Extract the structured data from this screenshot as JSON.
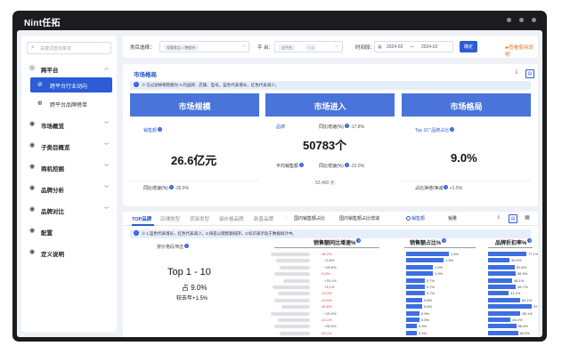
{
  "window": {
    "logo": "Nint任拓"
  },
  "sidebar": {
    "search_placeholder": "关键词查找菜单",
    "items": [
      {
        "label": "跨平台",
        "icon": "target-icon",
        "expanded": true
      },
      {
        "label": "跨平台行业动向",
        "sub": true,
        "active": true
      },
      {
        "label": "跨平台品牌榜单",
        "sub": true,
        "active": false
      },
      {
        "label": "市场概览",
        "icon": "grid-icon"
      },
      {
        "label": "子类目概览",
        "icon": "layers-icon"
      },
      {
        "label": "商机挖掘",
        "icon": "briefcase-icon"
      },
      {
        "label": "品牌分析",
        "icon": "chart-icon"
      },
      {
        "label": "品牌对比",
        "icon": "compare-icon"
      },
      {
        "label": "配置",
        "icon": "settings-icon"
      },
      {
        "label": "定义说明",
        "icon": "info-icon"
      }
    ]
  },
  "filters": {
    "category_label": "类目选择：",
    "category_tag": "保健食品 > 膳食补",
    "platform_label": "平 台：",
    "platform_tag": "全平台",
    "platform_more": "+ 4",
    "time_label": "时间段：",
    "date_start": "2024-02",
    "date_sep": "—",
    "date_end": "2024-02",
    "confirm_label": "确定",
    "help_label": "查看使用说明"
  },
  "market_panel": {
    "title": "市场格局",
    "notice": "① 已过滤掉销售额为 0 的品牌、店铺、型号。蓝色代表增长，红色代表减少。",
    "cards": [
      {
        "head": "市场规模",
        "metric_label": "销售额",
        "value": "26.6亿元",
        "yoy_label": "同比增速(%)",
        "yoy_value": "-35.9%"
      },
      {
        "head": "市场进入",
        "metric_label": "品牌",
        "yoy_label": "同比增速(%)",
        "yoy_value": "-17.8%",
        "value": "50783个",
        "avg_label": "平均销售额",
        "avg_yoy_label": "同比增速(%)",
        "avg_yoy_value": "-22.0%",
        "avg_value": "52,460 元"
      },
      {
        "head": "市场格局",
        "metric_label": "Top 10 \"品牌占比",
        "value": "9.0%",
        "yoy_label": "占比净增/净减",
        "yoy_value": "+1.5%"
      }
    ]
  },
  "brand_panel": {
    "tabs": [
      "TOP品牌",
      "店铺类型",
      "货架类型",
      "接价格品牌",
      "新晋品牌"
    ],
    "subtabs": [
      "国内销售额占比",
      "国内销售额占比增减",
      "销售额",
      "销量"
    ],
    "notice": "① 1.蓝色代表增长，红色代表减少。2.排名以销售额排序。3.标识表示处于数据统计中。",
    "rank_label": "按价格段筛选",
    "rank_title": "Top 1 - 10",
    "rank_share": "占 9.0%",
    "rank_yoy": "较去年+1.5%",
    "columns": [
      "销售额同比增速%",
      "销售额占比%",
      "品牌折扣率%"
    ],
    "rows": [
      {
        "yoy": "-35.2%",
        "yoy_neg": true,
        "share": 1.6,
        "share_label": "1.6%",
        "discount": 77.1,
        "discount_label": "77.1%"
      },
      {
        "yoy": "+2.6%",
        "yoy_neg": false,
        "share": 1.4,
        "share_label": "1.4%",
        "discount": 43.0,
        "discount_label": "43.0%"
      },
      {
        "yoy": "+28.8%",
        "yoy_neg": false,
        "share": 1.0,
        "share_label": "1.0%",
        "discount": 53.6,
        "discount_label": "53.6%"
      },
      {
        "yoy": "-5.0%",
        "yoy_neg": true,
        "share": 1.0,
        "share_label": "1.0%",
        "discount": 55.3,
        "discount_label": "55.3%"
      },
      {
        "yoy": "+76.1%",
        "yoy_neg": false,
        "share": 0.7,
        "share_label": "0.7%",
        "discount": 48.1,
        "discount_label": "48.1%"
      },
      {
        "yoy": "+1.1%",
        "yoy_neg": false,
        "share": 0.7,
        "share_label": "0.7%",
        "discount": 55.7,
        "discount_label": "55.7%"
      },
      {
        "yoy": "-13.3%",
        "yoy_neg": true,
        "share": 0.7,
        "share_label": "0.7%",
        "discount": 41.1,
        "discount_label": "41.1%"
      },
      {
        "yoy": "-24.0%",
        "yoy_neg": true,
        "share": 0.6,
        "share_label": "0.6%",
        "discount": 64.1,
        "discount_label": "64.1%"
      },
      {
        "yoy": "-45.8%",
        "yoy_neg": true,
        "share": 0.6,
        "share_label": "0.6%",
        "discount": 87.9,
        "discount_label": "87.9%"
      },
      {
        "yoy": "+20.3%",
        "yoy_neg": false,
        "share": 0.5,
        "share_label": "0.5%",
        "discount": 65.1,
        "discount_label": "65.1%"
      },
      {
        "yoy": "-10.1%",
        "yoy_neg": true,
        "share": 0.5,
        "share_label": "0.5%",
        "discount": 45.2,
        "discount_label": "45.2%"
      },
      {
        "yoy": "+35.3%",
        "yoy_neg": false,
        "share": 0.4,
        "share_label": "0.4%",
        "discount": 56.4,
        "discount_label": "56.4%"
      },
      {
        "yoy": "-45.1%",
        "yoy_neg": true,
        "share": 0.4,
        "share_label": "0.4%",
        "discount": 60.0,
        "discount_label": "60.0%"
      }
    ]
  },
  "colors": {
    "accent": "#2e5bd6",
    "card_head": "#4a74da",
    "negative": "#e23c3c",
    "link": "#e2771f"
  }
}
